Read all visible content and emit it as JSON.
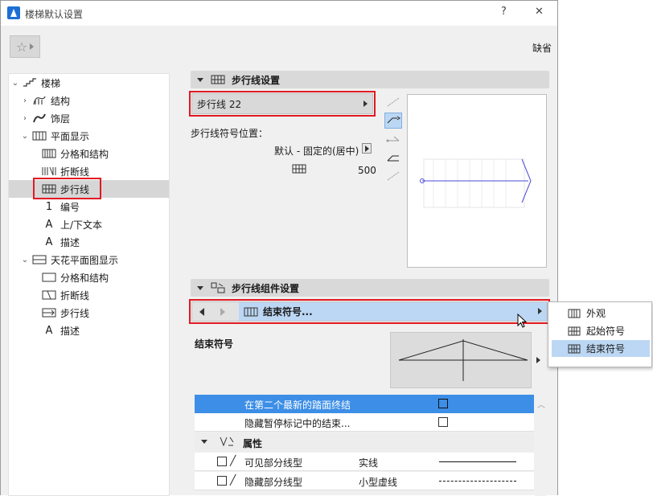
{
  "window": {
    "title": "楼梯默认设置",
    "help": "?",
    "close": "✕"
  },
  "toolbar": {
    "default_label": "缺省",
    "favorites_icon": "star-icon"
  },
  "tree": [
    {
      "label": "楼梯",
      "level": 0,
      "expanded": true
    },
    {
      "label": "结构",
      "level": 1,
      "chevron": "›"
    },
    {
      "label": "饰层",
      "level": 1,
      "chevron": "›"
    },
    {
      "label": "平面显示",
      "level": 1,
      "chevron": "⌄"
    },
    {
      "label": "分格和结构",
      "level": 2
    },
    {
      "label": "折断线",
      "level": 2
    },
    {
      "label": "步行线",
      "level": 2,
      "selected": true
    },
    {
      "label": "编号",
      "level": 2
    },
    {
      "label": "上/下文本",
      "level": 2
    },
    {
      "label": "描述",
      "level": 2
    },
    {
      "label": "天花平面图显示",
      "level": 1,
      "chevron": "⌄"
    },
    {
      "label": "分格和结构",
      "level": 2
    },
    {
      "label": "折断线",
      "level": 2
    },
    {
      "label": "步行线",
      "level": 2
    },
    {
      "label": "描述",
      "level": 2
    }
  ],
  "walkline_settings": {
    "header": "步行线设置",
    "selector_value": "步行线 22",
    "position_label": "步行线符号位置：",
    "position_value": "默认 - 固定的(居中)",
    "offset_value": "500"
  },
  "component_settings": {
    "header": "步行线组件设置",
    "selector_value": "结束符号...",
    "end_symbol_label": "结束符号"
  },
  "popup_menu": {
    "items": [
      "外观",
      "起始符号",
      "结束符号"
    ],
    "selected": "结束符号"
  },
  "properties": {
    "rows": [
      {
        "label": "在第二个最新的踏面终结",
        "checked": false,
        "highlighted": true
      },
      {
        "label": "隐藏暂停标记中的结束...",
        "checked": false
      }
    ],
    "group_header": "属性",
    "lines": [
      {
        "label": "可见部分线型",
        "value": "实线"
      },
      {
        "label": "隐藏部分线型",
        "value": "小型虚线"
      }
    ]
  },
  "colors": {
    "accent_blue": "#3c8ee6",
    "highlight_red": "#e11a22",
    "selection_bg": "#d6d6d6",
    "combo_blue": "#bcd7f3"
  }
}
